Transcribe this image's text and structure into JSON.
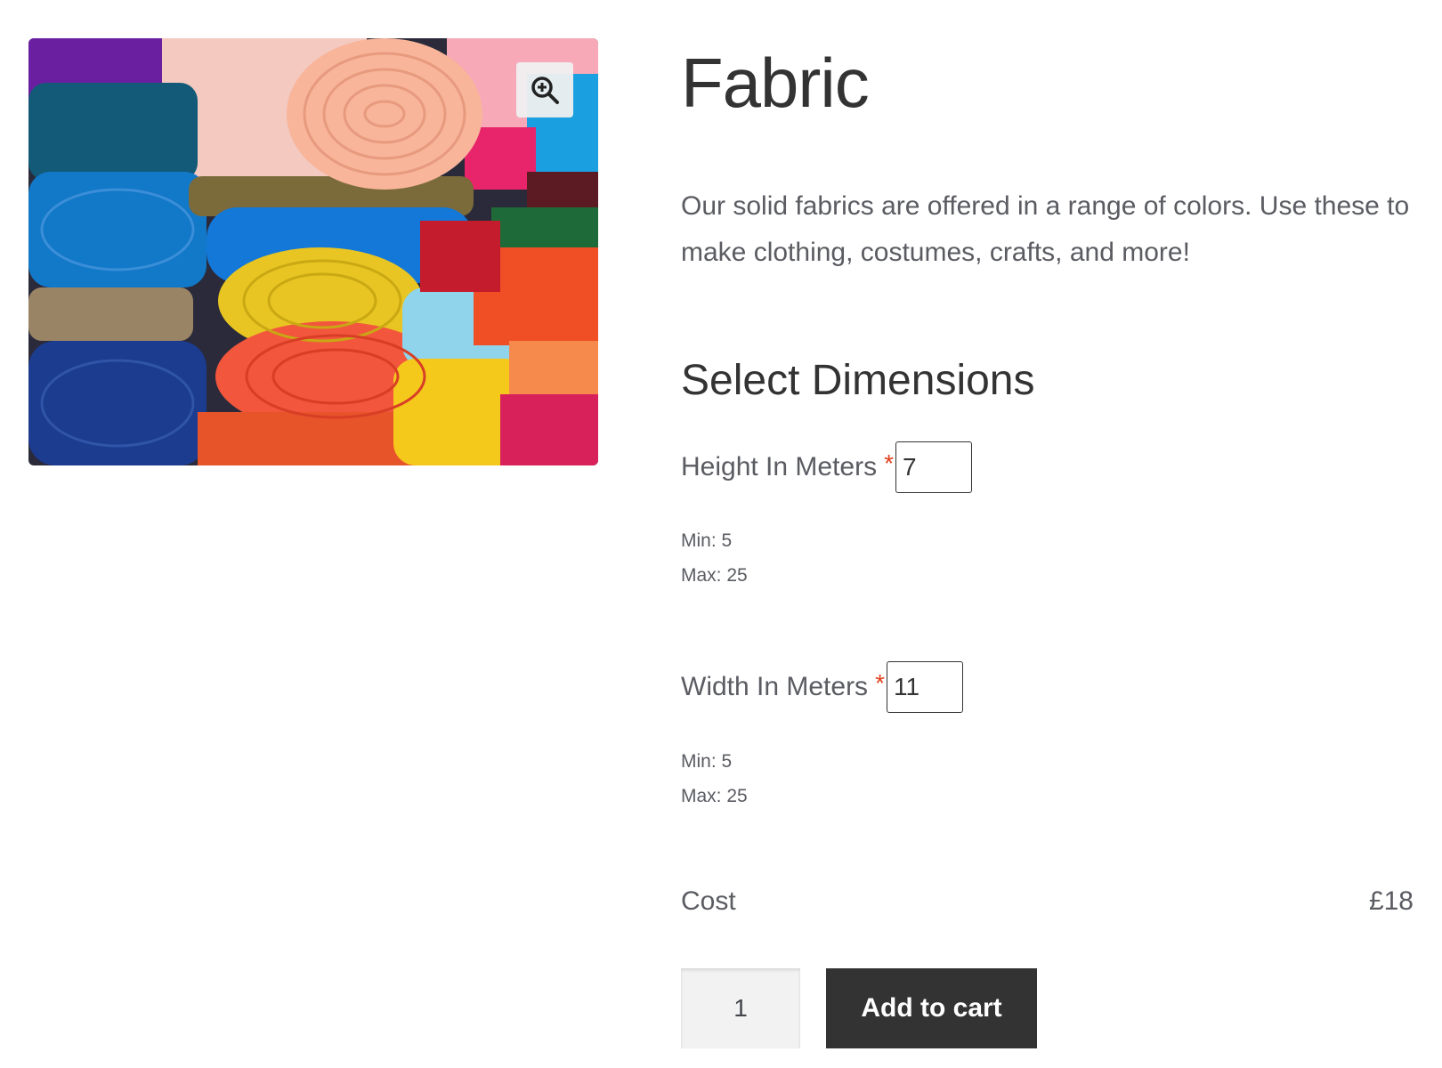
{
  "product": {
    "title": "Fabric",
    "description": "Our solid fabrics are offered in a range of colors. Use these to make clothing, costumes, crafts, and more!",
    "image_icon": "zoom-in-icon"
  },
  "dimensions": {
    "heading": "Select Dimensions",
    "height": {
      "label": "Height In Meters",
      "required_mark": "*",
      "value": "7",
      "min_text": "Min: 5",
      "max_text": "Max: 25"
    },
    "width": {
      "label": "Width In Meters",
      "required_mark": "*",
      "value": "11",
      "min_text": "Min: 5",
      "max_text": "Max: 25"
    }
  },
  "cost": {
    "label": "Cost",
    "value": "£18"
  },
  "cart": {
    "quantity": "1",
    "button_label": "Add to cart"
  },
  "colors": {
    "button_bg": "#333333",
    "required": "#e2401c",
    "text": "#43454b"
  }
}
